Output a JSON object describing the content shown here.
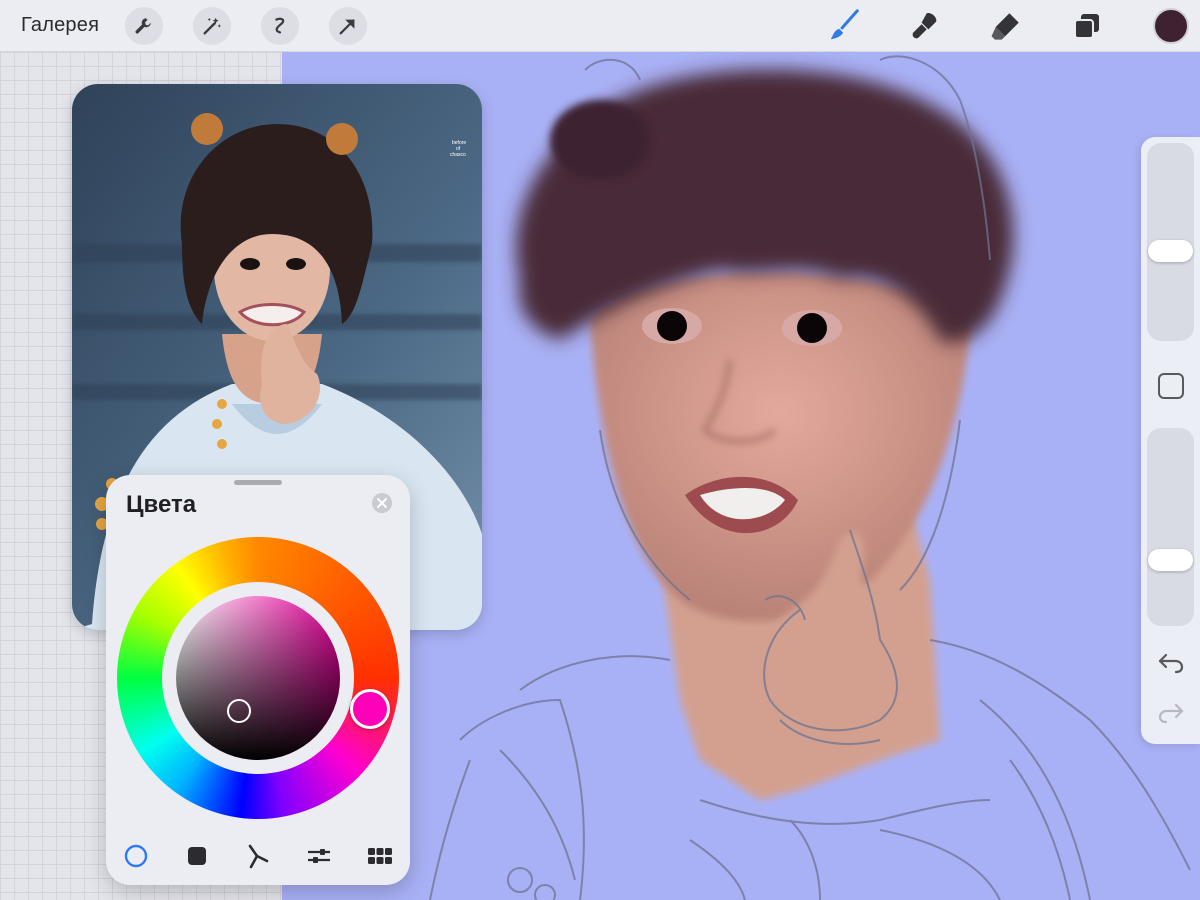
{
  "toolbar": {
    "gallery_label": "Галерея",
    "left_tools": [
      {
        "icon": "wrench-icon"
      },
      {
        "icon": "magic-wand-icon"
      },
      {
        "icon": "selection-icon"
      },
      {
        "icon": "transform-arrow-icon"
      }
    ],
    "right_tools": [
      {
        "icon": "brush-icon",
        "active": true
      },
      {
        "icon": "smudge-icon"
      },
      {
        "icon": "eraser-icon"
      },
      {
        "icon": "layers-icon"
      }
    ],
    "current_color": "#3e2232",
    "accent": "#2f7bea"
  },
  "reference": {
    "kind": "photo-reference",
    "watermark": "before\nof\nchasco"
  },
  "side_panel": {
    "brush_size_level": 0.45,
    "opacity_level": 0.31,
    "modify_icon": "square-modify-icon",
    "undo_icon": "undo-icon",
    "redo_icon": "redo-icon"
  },
  "colors_panel": {
    "title": "Цвета",
    "close_icon": "close-icon",
    "hue_color": "#ff00b8",
    "tabs": [
      {
        "icon": "disc-icon",
        "active": true
      },
      {
        "icon": "classic-square-icon"
      },
      {
        "icon": "harmony-icon"
      },
      {
        "icon": "value-sliders-icon"
      },
      {
        "icon": "palettes-grid-icon"
      }
    ]
  }
}
